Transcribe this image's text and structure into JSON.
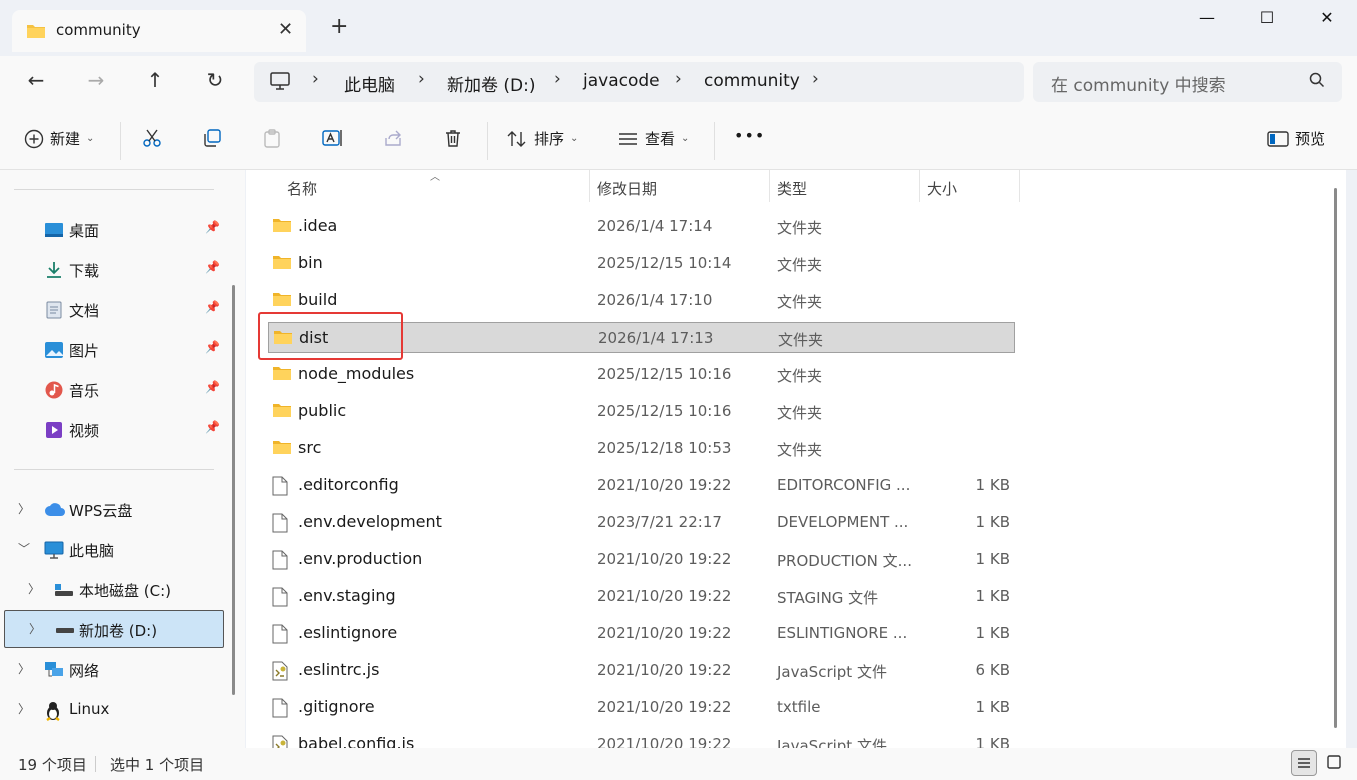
{
  "window": {
    "tab_title": "community",
    "new_tab": "+",
    "minimize": "—",
    "maximize": "☐",
    "close": "✕",
    "tab_close": "✕"
  },
  "nav": {
    "back": "←",
    "forward": "→",
    "up": "↑",
    "refresh": "↻",
    "breadcrumb": [
      "此电脑",
      "新加卷 (D:)",
      "javacode",
      "community"
    ],
    "search_placeholder": "在 community 中搜索"
  },
  "toolbar": {
    "new_label": "新建",
    "sort_label": "排序",
    "view_label": "查看",
    "more_label": "•••",
    "preview_label": "预览"
  },
  "sidebar": {
    "quick_access": [
      {
        "label": "桌面",
        "icon": "desktop-icon"
      },
      {
        "label": "下载",
        "icon": "download-icon"
      },
      {
        "label": "文档",
        "icon": "document-icon"
      },
      {
        "label": "图片",
        "icon": "pictures-icon"
      },
      {
        "label": "音乐",
        "icon": "music-icon"
      },
      {
        "label": "视频",
        "icon": "video-icon"
      }
    ],
    "tree": [
      {
        "label": "WPS云盘",
        "icon": "cloud-icon"
      },
      {
        "label": "此电脑",
        "icon": "computer-icon"
      },
      {
        "label": "本地磁盘 (C:)",
        "icon": "drive-icon"
      },
      {
        "label": "新加卷 (D:)",
        "icon": "drive-icon"
      },
      {
        "label": "网络",
        "icon": "network-icon"
      },
      {
        "label": "Linux",
        "icon": "linux-icon"
      }
    ]
  },
  "columns": {
    "name": "名称",
    "date": "修改日期",
    "type": "类型",
    "size": "大小"
  },
  "files": [
    {
      "name": ".idea",
      "date": "2026/1/4 17:14",
      "type": "文件夹",
      "size": "",
      "kind": "folder"
    },
    {
      "name": "bin",
      "date": "2025/12/15 10:14",
      "type": "文件夹",
      "size": "",
      "kind": "folder"
    },
    {
      "name": "build",
      "date": "2026/1/4 17:10",
      "type": "文件夹",
      "size": "",
      "kind": "folder"
    },
    {
      "name": "dist",
      "date": "2026/1/4 17:13",
      "type": "文件夹",
      "size": "",
      "kind": "folder"
    },
    {
      "name": "node_modules",
      "date": "2025/12/15 10:16",
      "type": "文件夹",
      "size": "",
      "kind": "folder"
    },
    {
      "name": "public",
      "date": "2025/12/15 10:16",
      "type": "文件夹",
      "size": "",
      "kind": "folder"
    },
    {
      "name": "src",
      "date": "2025/12/18 10:53",
      "type": "文件夹",
      "size": "",
      "kind": "folder"
    },
    {
      "name": ".editorconfig",
      "date": "2021/10/20 19:22",
      "type": "EDITORCONFIG ...",
      "size": "1 KB",
      "kind": "file"
    },
    {
      "name": ".env.development",
      "date": "2023/7/21 22:17",
      "type": "DEVELOPMENT ...",
      "size": "1 KB",
      "kind": "file"
    },
    {
      "name": ".env.production",
      "date": "2021/10/20 19:22",
      "type": "PRODUCTION 文...",
      "size": "1 KB",
      "kind": "file"
    },
    {
      "name": ".env.staging",
      "date": "2021/10/20 19:22",
      "type": "STAGING 文件",
      "size": "1 KB",
      "kind": "file"
    },
    {
      "name": ".eslintignore",
      "date": "2021/10/20 19:22",
      "type": "ESLINTIGNORE ...",
      "size": "1 KB",
      "kind": "file"
    },
    {
      "name": ".eslintrc.js",
      "date": "2021/10/20 19:22",
      "type": "JavaScript 文件",
      "size": "6 KB",
      "kind": "js"
    },
    {
      "name": ".gitignore",
      "date": "2021/10/20 19:22",
      "type": "txtfile",
      "size": "1 KB",
      "kind": "file"
    },
    {
      "name": "babel.config.js",
      "date": "2021/10/20 19:22",
      "type": "JavaScript 文件",
      "size": "1 KB",
      "kind": "js"
    }
  ],
  "selected_file": "dist",
  "status": {
    "count": "19 个项目",
    "selected": "选中 1 个项目"
  },
  "colors": {
    "accent": "#0067c0",
    "folder": "#f5c242",
    "highlight_box": "#e53935",
    "selection": "#d9d9d9"
  }
}
